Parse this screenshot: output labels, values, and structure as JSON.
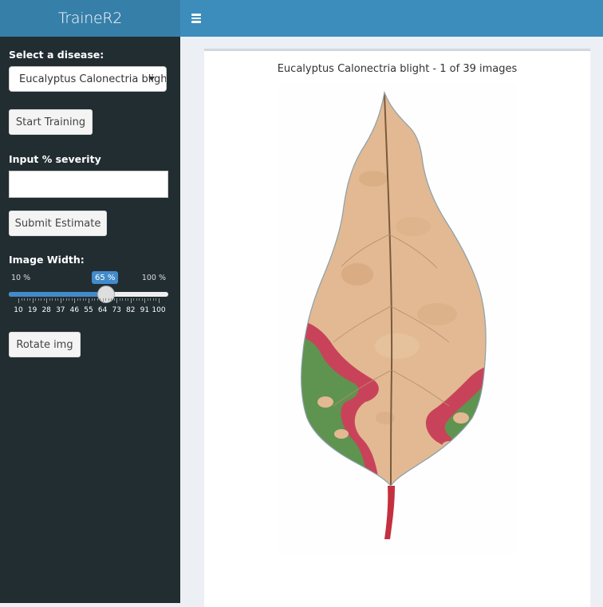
{
  "app": {
    "title": "TraineR2"
  },
  "sidebar": {
    "disease_label": "Select a disease:",
    "disease_selected": "Eucalyptus Calonectria blight",
    "start_button": "Start Training",
    "severity_label": "Input % severity",
    "severity_value": "",
    "submit_button": "Submit Estimate",
    "width_label": "Image Width:",
    "slider": {
      "min_label": "10 %",
      "max_label": "100 %",
      "value_label": "65 %",
      "min": 10,
      "max": 100,
      "value": 65,
      "ticks": [
        "10",
        "19",
        "28",
        "37",
        "46",
        "55",
        "64",
        "73",
        "82",
        "91",
        "100"
      ]
    },
    "rotate_button": "Rotate img"
  },
  "main": {
    "caption": "Eucalyptus Calonectria blight - 1 of 39 images",
    "image_subject": "eucalyptus-leaf-image"
  },
  "colors": {
    "header_logo": "#367fa9",
    "header_bar": "#3c8dbc",
    "sidebar": "#222d32",
    "accent": "#428bca"
  }
}
